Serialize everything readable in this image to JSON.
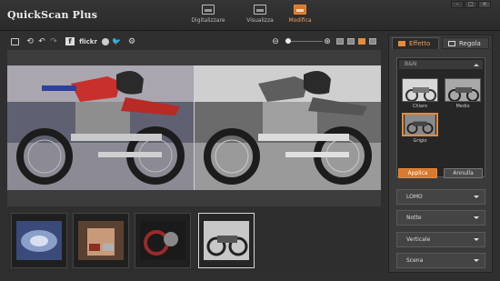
{
  "app": {
    "title": "QuickScan Plus"
  },
  "modes": [
    {
      "label": "Digitalizzare",
      "icon": "scanner-icon"
    },
    {
      "label": "Visualizza",
      "icon": "gallery-icon"
    },
    {
      "label": "Modifica",
      "icon": "edit-photo-icon",
      "active": true
    }
  ],
  "toolbar": {
    "flickr_label": "flickr",
    "icons": [
      "save-icon",
      "rotate-icon",
      "undo-icon",
      "redo-icon",
      "facebook-icon",
      "flickr-logo",
      "web-icon",
      "twitter-icon",
      "settings-icon",
      "zoom-out-icon",
      "zoom-in-icon"
    ],
    "zoom_level": 0.1
  },
  "viewer": {
    "mode": "split before/after"
  },
  "filmstrip": {
    "count": 4,
    "selected_index": 3
  },
  "panel": {
    "tabs": [
      {
        "label": "Effetto",
        "active": true
      },
      {
        "label": "Regola"
      }
    ],
    "preset_group": "B&N",
    "presets": [
      {
        "label": "Chiaro"
      },
      {
        "label": "Medio"
      },
      {
        "label": "Grigio",
        "selected": true
      }
    ],
    "apply_label": "Applica",
    "cancel_label": "Annulla",
    "dropdowns": [
      "LOMO",
      "Notte",
      "Verticale",
      "Scena"
    ]
  },
  "colors": {
    "accent": "#e58a3b",
    "bg": "#2f2f2f"
  }
}
